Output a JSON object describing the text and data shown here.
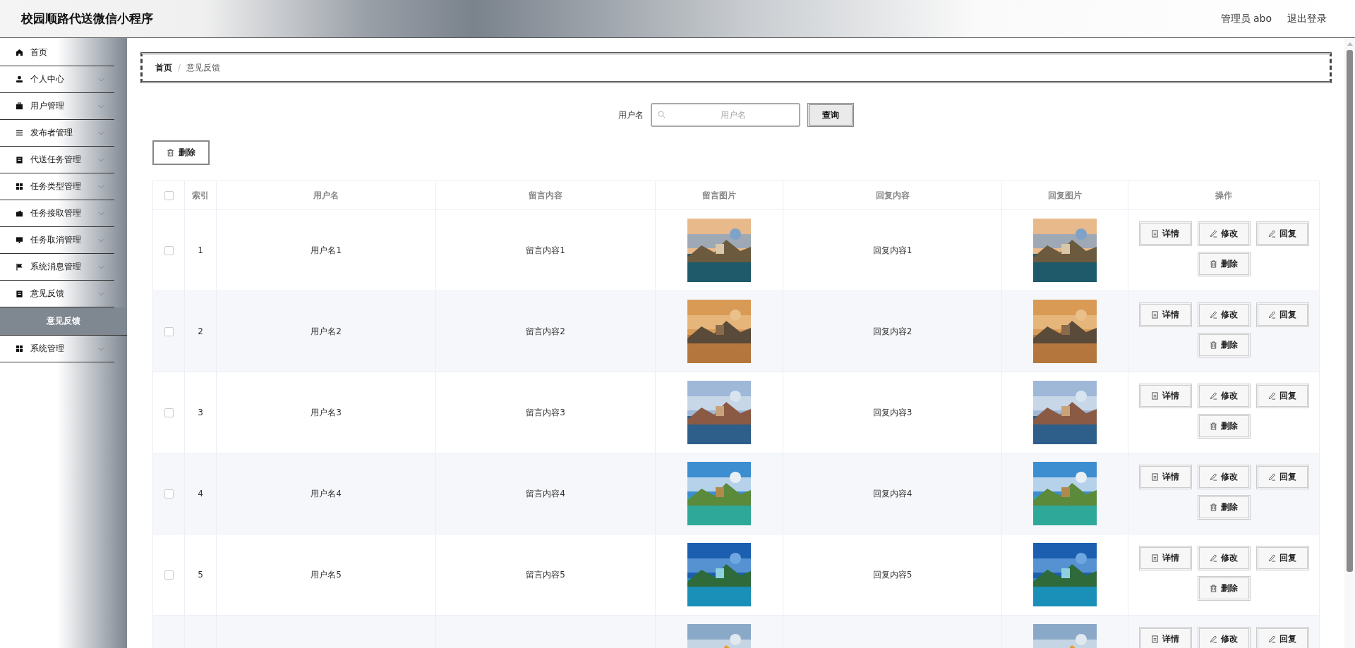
{
  "header": {
    "title": "校园顺路代送微信小程序",
    "user": "管理员 abo",
    "logout": "退出登录"
  },
  "sidebar": {
    "items": [
      {
        "label": "首页",
        "kind": "link"
      },
      {
        "label": "个人中心",
        "kind": "submenu"
      },
      {
        "label": "用户管理",
        "kind": "submenu"
      },
      {
        "label": "发布者管理",
        "kind": "submenu"
      },
      {
        "label": "代送任务管理",
        "kind": "submenu"
      },
      {
        "label": "任务类型管理",
        "kind": "submenu"
      },
      {
        "label": "任务接取管理",
        "kind": "submenu"
      },
      {
        "label": "任务取消管理",
        "kind": "submenu"
      },
      {
        "label": "系统消息管理",
        "kind": "submenu"
      },
      {
        "label": "意见反馈",
        "kind": "submenu",
        "children": [
          {
            "label": "意见反馈",
            "selected": true
          }
        ]
      },
      {
        "label": "系统管理",
        "kind": "submenu"
      }
    ]
  },
  "breadcrumb": {
    "items": [
      "首页",
      "意见反馈"
    ],
    "separator": "/"
  },
  "search": {
    "label": "用户名",
    "placeholder": "用户名",
    "button": "查询"
  },
  "toolbar": {
    "delete_button": "删除"
  },
  "table": {
    "select_all": false,
    "columns": [
      "索引",
      "用户名",
      "留言内容",
      "留言图片",
      "回复内容",
      "回复图片",
      "操作"
    ],
    "rows": [
      {
        "checked": false,
        "index": "1",
        "username": "用户名1",
        "message": "留言内容1",
        "message_image": {
          "kind": "picture"
        },
        "reply": "回复内容1",
        "reply_image": {
          "kind": "picture"
        },
        "actions": [
          "详情",
          "修改",
          "回复",
          "删除"
        ]
      },
      {
        "checked": false,
        "index": "2",
        "username": "用户名2",
        "message": "留言内容2",
        "message_image": {
          "kind": "picture"
        },
        "reply": "回复内容2",
        "reply_image": {
          "kind": "picture"
        },
        "actions": [
          "详情",
          "修改",
          "回复",
          "删除"
        ]
      },
      {
        "checked": false,
        "index": "3",
        "username": "用户名3",
        "message": "留言内容3",
        "message_image": {
          "kind": "picture"
        },
        "reply": "回复内容3",
        "reply_image": {
          "kind": "picture"
        },
        "actions": [
          "详情",
          "修改",
          "回复",
          "删除"
        ]
      },
      {
        "checked": false,
        "index": "4",
        "username": "用户名4",
        "message": "留言内容4",
        "message_image": {
          "kind": "picture"
        },
        "reply": "回复内容4",
        "reply_image": {
          "kind": "picture"
        },
        "actions": [
          "详情",
          "修改",
          "回复",
          "删除"
        ]
      },
      {
        "checked": false,
        "index": "5",
        "username": "用户名5",
        "message": "留言内容5",
        "message_image": {
          "kind": "picture"
        },
        "reply": "回复内容5",
        "reply_image": {
          "kind": "picture"
        },
        "actions": [
          "详情",
          "修改",
          "回复",
          "删除"
        ]
      },
      {
        "message_image": {
          "kind": "picture"
        },
        "reply_image": {
          "kind": "picture"
        },
        "actions": [
          "详情",
          "修改",
          "回复"
        ]
      }
    ]
  }
}
